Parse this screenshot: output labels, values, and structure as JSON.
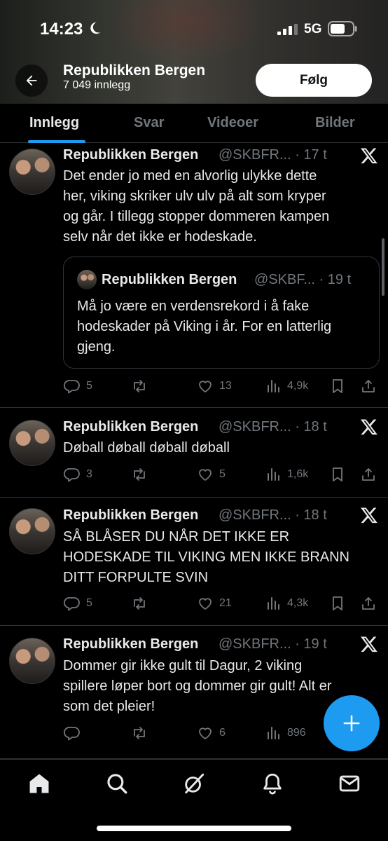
{
  "status_bar": {
    "time": "14:23",
    "network": "5G"
  },
  "header": {
    "title": "Republikken Bergen",
    "post_count": "7 049 innlegg",
    "follow_label": "Følg"
  },
  "tabs": [
    {
      "label": "Innlegg",
      "active": true
    },
    {
      "label": "Svar",
      "active": false
    },
    {
      "label": "Videoer",
      "active": false
    },
    {
      "label": "Bilder",
      "active": false
    }
  ],
  "tweets": [
    {
      "name": "Republikken Bergen",
      "handle": "@SKBFR... · 17 t",
      "lines": [
        "Det ender jo med en alvorlig ulykke dette",
        "her, viking skriker ulv ulv på alt som kryper",
        "og går. I tillegg stopper dommeren kampen",
        "selv når det ikke er hodeskade."
      ],
      "quote": {
        "name": "Republikken Bergen",
        "handle": "@SKBF... · 19 t",
        "lines": [
          "Må jo være en verdensrekord i å fake",
          "hodeskader på Viking i år. For en latterlig",
          "gjeng."
        ]
      },
      "replies": "5",
      "reposts": "",
      "likes": "13",
      "views": "4,9k"
    },
    {
      "name": "Republikken Bergen",
      "handle": "@SKBFR... · 18 t",
      "lines": [
        "Døball døball døball døball"
      ],
      "replies": "3",
      "reposts": "",
      "likes": "5",
      "views": "1,6k"
    },
    {
      "name": "Republikken Bergen",
      "handle": "@SKBFR... · 18 t",
      "lines": [
        "SÅ BLÅSER DU NÅR DET IKKE ER",
        "HODESKADE TIL VIKING MEN IKKE BRANN",
        "DITT FORPULTE SVIN"
      ],
      "replies": "5",
      "reposts": "",
      "likes": "21",
      "views": "4,3k"
    },
    {
      "name": "Republikken Bergen",
      "handle": "@SKBFR... · 19 t",
      "lines": [
        "Dommer gir ikke gult til Dagur, 2 viking",
        "spillere løper bort og dommer gir gult! Alt er",
        "som det pleier!"
      ],
      "replies": "",
      "reposts": "",
      "likes": "6",
      "views": "896"
    }
  ],
  "icons": {
    "back": "arrow-left-icon",
    "x_logo": "x-logo-icon",
    "reply": "reply-icon",
    "repost": "repost-icon",
    "like": "heart-icon",
    "views": "views-icon",
    "bookmark": "bookmark-icon",
    "share": "share-icon",
    "compose": "plus-icon",
    "nav": [
      "home-icon",
      "search-icon",
      "grok-icon",
      "bell-icon",
      "mail-icon"
    ]
  },
  "colors": {
    "accent": "#1d9bf0",
    "muted": "#71767b",
    "text": "#e7e9ea",
    "border": "#2f3336"
  }
}
